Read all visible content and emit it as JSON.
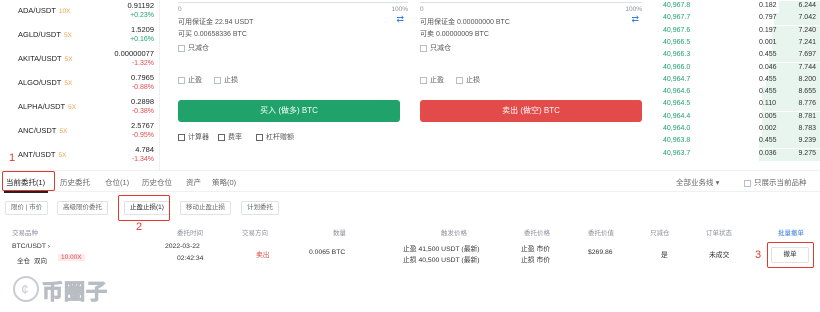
{
  "market": [
    {
      "symbol": "ADA/USDT",
      "leverage": "10X",
      "price": "0.91192",
      "change": "+0.23%",
      "dir": "up"
    },
    {
      "symbol": "AGLD/USDT",
      "leverage": "5X",
      "price": "1.5209",
      "change": "+0.16%",
      "dir": "up"
    },
    {
      "symbol": "AKITA/USDT",
      "leverage": "5X",
      "price": "0.00000077",
      "change": "-1.32%",
      "dir": "down"
    },
    {
      "symbol": "ALGO/USDT",
      "leverage": "5X",
      "price": "0.7965",
      "change": "-0.88%",
      "dir": "down"
    },
    {
      "symbol": "ALPHA/USDT",
      "leverage": "5X",
      "price": "0.2898",
      "change": "-0.38%",
      "dir": "down"
    },
    {
      "symbol": "ANC/USDT",
      "leverage": "5X",
      "price": "2.5767",
      "change": "-0.95%",
      "dir": "down"
    },
    {
      "symbol": "ANT/USDT",
      "leverage": "5X",
      "price": "4.784",
      "change": "-1.34%",
      "dir": "down"
    }
  ],
  "buy_form": {
    "slider_min": "0",
    "slider_max": "100%",
    "available_label": "可用保证金 22.94 USDT",
    "can_buy_label": "可买 0.00658336 BTC",
    "reduce_only": "只减仓",
    "take_profit": "止盈",
    "stop_loss": "止损",
    "button": "买入 (做多) BTC",
    "calculator": "计算器",
    "fees": "费率",
    "leverage_bonus": "杠杆赠额"
  },
  "sell_form": {
    "slider_min": "0",
    "slider_max": "100%",
    "available_label": "可用保证金 0.00000000 BTC",
    "can_sell_label": "可卖 0.00000009 BTC",
    "reduce_only": "只减仓",
    "take_profit": "止盈",
    "stop_loss": "止损",
    "button": "卖出 (做空) BTC"
  },
  "order_book": [
    {
      "price": "40,967.8",
      "qty": "0.182",
      "total": "6.244",
      "depth": 0.25
    },
    {
      "price": "40,967.7",
      "qty": "0.797",
      "total": "7.042",
      "depth": 0.28
    },
    {
      "price": "40,967.6",
      "qty": "0.197",
      "total": "7.240",
      "depth": 0.29
    },
    {
      "price": "40,966.5",
      "qty": "0.001",
      "total": "7.241",
      "depth": 0.29
    },
    {
      "price": "40,966.3",
      "qty": "0.455",
      "total": "7.697",
      "depth": 0.31
    },
    {
      "price": "40,966.0",
      "qty": "0.046",
      "total": "7.744",
      "depth": 0.31
    },
    {
      "price": "40,964.7",
      "qty": "0.455",
      "total": "8.200",
      "depth": 0.33
    },
    {
      "price": "40,964.6",
      "qty": "0.455",
      "total": "8.655",
      "depth": 0.35
    },
    {
      "price": "40,964.5",
      "qty": "0.110",
      "total": "8.776",
      "depth": 0.35
    },
    {
      "price": "40,964.4",
      "qty": "0.005",
      "total": "8.781",
      "depth": 0.35
    },
    {
      "price": "40,964.0",
      "qty": "0.002",
      "total": "8.783",
      "depth": 0.35
    },
    {
      "price": "40,963.8",
      "qty": "0.455",
      "total": "9.239",
      "depth": 0.37
    },
    {
      "price": "40,963.7",
      "qty": "0.036",
      "total": "9.275",
      "depth": 0.37
    }
  ],
  "tabs": [
    "当前委托(1)",
    "历史委托",
    "仓位(1)",
    "历史仓位",
    "资产",
    "策略(0)"
  ],
  "filter": {
    "all_business": "全部业务线",
    "only_current": "只展示当前品种"
  },
  "subtabs": [
    "限价 | 市价",
    "高级限价委托",
    "止盈止损(1)",
    "移动止盈止损",
    "计划委托"
  ],
  "table_headers": {
    "instrument": "交易品种",
    "time": "委托时间",
    "side": "交易方向",
    "qty": "数量",
    "trigger": "触发价格",
    "order_price": "委托价格",
    "order_value": "委托价值",
    "reduce": "只减仓",
    "status": "订单状态",
    "batch_cancel": "批量撤单"
  },
  "order_row": {
    "symbol": "BTC/USDT",
    "mode": "全仓",
    "type": "双向",
    "lev": "10.00X",
    "date": "2022-03-22",
    "time": "02:42:34",
    "side": "卖出",
    "qty": "0.0065 BTC",
    "trigger_tp": "止盈 41,500 USDT (最新)",
    "trigger_sl": "止损 40,500 USDT (最新)",
    "price_tp": "止盈 市价",
    "price_sl": "止损 市价",
    "value": "$269.86",
    "reduce": "是",
    "status": "未成交",
    "cancel": "撤单"
  },
  "annotations": {
    "one": "1",
    "two": "2",
    "three": "3"
  },
  "watermark": "币圈子",
  "colors": {
    "up": "#1fa36a",
    "down": "#e34a4a",
    "buy": "#1fa36a",
    "sell": "#e34a4a",
    "highlight": "#e03a2f",
    "link": "#3b7ddd"
  }
}
